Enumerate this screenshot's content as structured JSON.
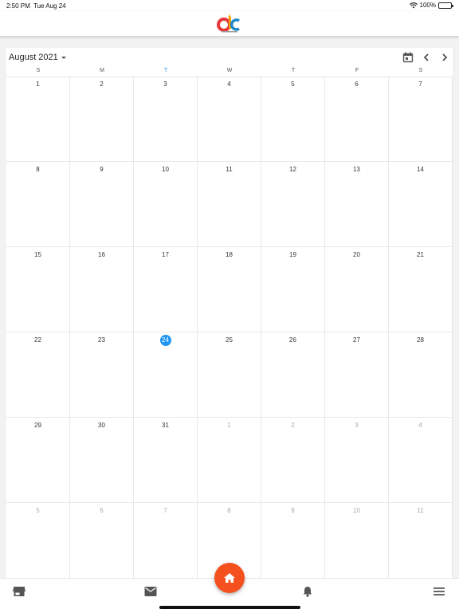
{
  "status_bar": {
    "time": "2:50 PM",
    "date": "Tue Aug 24",
    "battery": "100%"
  },
  "calendar": {
    "month_label": "August 2021",
    "weekdays": [
      "S",
      "M",
      "T",
      "W",
      "T",
      "F",
      "S"
    ],
    "today_column": 2,
    "weeks": [
      [
        {
          "d": "1",
          "o": false
        },
        {
          "d": "2",
          "o": false
        },
        {
          "d": "3",
          "o": false
        },
        {
          "d": "4",
          "o": false
        },
        {
          "d": "5",
          "o": false
        },
        {
          "d": "6",
          "o": false
        },
        {
          "d": "7",
          "o": false
        }
      ],
      [
        {
          "d": "8",
          "o": false
        },
        {
          "d": "9",
          "o": false
        },
        {
          "d": "10",
          "o": false
        },
        {
          "d": "11",
          "o": false
        },
        {
          "d": "12",
          "o": false
        },
        {
          "d": "13",
          "o": false
        },
        {
          "d": "14",
          "o": false
        }
      ],
      [
        {
          "d": "15",
          "o": false
        },
        {
          "d": "16",
          "o": false
        },
        {
          "d": "17",
          "o": false
        },
        {
          "d": "18",
          "o": false
        },
        {
          "d": "19",
          "o": false
        },
        {
          "d": "20",
          "o": false
        },
        {
          "d": "21",
          "o": false
        }
      ],
      [
        {
          "d": "22",
          "o": false
        },
        {
          "d": "23",
          "o": false
        },
        {
          "d": "24",
          "o": false,
          "today": true
        },
        {
          "d": "25",
          "o": false
        },
        {
          "d": "26",
          "o": false
        },
        {
          "d": "27",
          "o": false
        },
        {
          "d": "28",
          "o": false
        }
      ],
      [
        {
          "d": "29",
          "o": false
        },
        {
          "d": "30",
          "o": false
        },
        {
          "d": "31",
          "o": false
        },
        {
          "d": "1",
          "o": true
        },
        {
          "d": "2",
          "o": true
        },
        {
          "d": "3",
          "o": true
        },
        {
          "d": "4",
          "o": true
        }
      ],
      [
        {
          "d": "5",
          "o": true
        },
        {
          "d": "6",
          "o": true
        },
        {
          "d": "7",
          "o": true
        },
        {
          "d": "8",
          "o": true
        },
        {
          "d": "9",
          "o": true
        },
        {
          "d": "10",
          "o": true
        },
        {
          "d": "11",
          "o": true
        }
      ]
    ]
  },
  "toolbar_icons": [
    "calendar-icon",
    "chevron-left-icon",
    "chevron-right-icon"
  ],
  "bottom_nav": {
    "items": [
      "store-icon",
      "mail-icon",
      "home-icon",
      "bell-icon",
      "menu-icon"
    ]
  },
  "colors": {
    "accent": "#2196f3",
    "fab": "#f4511e"
  }
}
